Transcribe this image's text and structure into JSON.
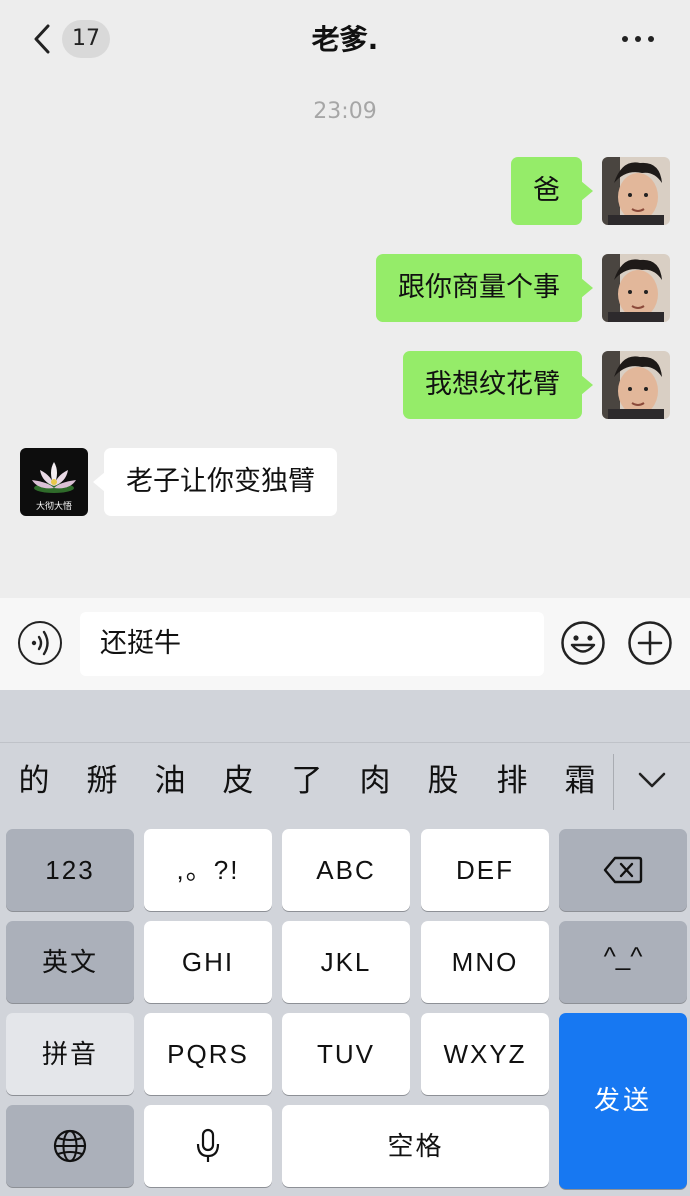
{
  "header": {
    "unread_count": "17",
    "title": "老爹."
  },
  "conversation": {
    "timestamp": "23:09",
    "messages": [
      {
        "from": "me",
        "text": "爸"
      },
      {
        "from": "me",
        "text": "跟你商量个事"
      },
      {
        "from": "me",
        "text": "我想纹花臂"
      },
      {
        "from": "them",
        "text": "老子让你变独臂"
      }
    ],
    "contact_avatar_caption": "大彻大悟"
  },
  "input": {
    "value": "还挺牛"
  },
  "keyboard": {
    "candidates": [
      "的",
      "掰",
      "油",
      "皮",
      "了",
      "肉",
      "股",
      "排",
      "霜"
    ],
    "keys": {
      "numbers": "123",
      "punct": ",。?!",
      "abc": "ABC",
      "def": "DEF",
      "english": "英文",
      "ghi": "GHI",
      "jkl": "JKL",
      "mno": "MNO",
      "emoticon": "^_^",
      "pinyin": "拼音",
      "pqrs": "PQRS",
      "tuv": "TUV",
      "wxyz": "WXYZ",
      "space": "空格",
      "send": "发送"
    }
  },
  "colors": {
    "sent_bubble": "#95ec69",
    "received_bubble": "#ffffff",
    "send_key": "#1778f2",
    "chat_background": "#ededed"
  }
}
